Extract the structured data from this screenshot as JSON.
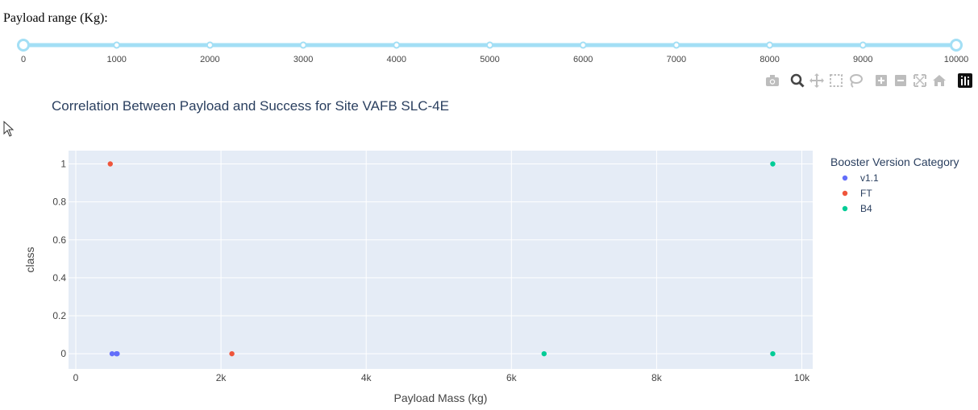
{
  "slider": {
    "label": "Payload range (Kg):",
    "min": 0,
    "max": 10000,
    "value_low": 0,
    "value_high": 10000,
    "marks": [
      "0",
      "1000",
      "2000",
      "3000",
      "4000",
      "5000",
      "6000",
      "7000",
      "8000",
      "9000",
      "10000"
    ],
    "track_color": "#a3dff5",
    "handle_color": "#a3dff5"
  },
  "modebar": {
    "icons": [
      "camera-icon",
      "zoom-icon",
      "pan-icon",
      "box-select-icon",
      "lasso-select-icon",
      "zoom-in-icon",
      "zoom-out-icon",
      "autoscale-icon",
      "reset-axes-icon",
      "plotly-logo-icon"
    ]
  },
  "chart_data": {
    "type": "scatter",
    "title": "Correlation Between Payload and Success for Site VAFB SLC-4E",
    "xlabel": "Payload Mass (kg)",
    "ylabel": "class",
    "xlim": [
      -100,
      10150
    ],
    "ylim": [
      -0.08,
      1.07
    ],
    "x_ticks": [
      0,
      2000,
      4000,
      6000,
      8000,
      10000
    ],
    "x_tick_labels": [
      "0",
      "2k",
      "4k",
      "6k",
      "8k",
      "10k"
    ],
    "y_ticks": [
      0,
      0.2,
      0.4,
      0.6,
      0.8,
      1
    ],
    "y_tick_labels": [
      "0",
      "0.2",
      "0.4",
      "0.6",
      "0.8",
      "1"
    ],
    "grid": true,
    "legend_title": "Booster Version Category",
    "legend_position": "right",
    "series": [
      {
        "name": "v1.1",
        "color": "#636efa",
        "points": [
          [
            500,
            0
          ],
          [
            560,
            0
          ],
          [
            570,
            0
          ]
        ]
      },
      {
        "name": "FT",
        "color": "#ef553b",
        "points": [
          [
            475,
            1
          ],
          [
            2150,
            0
          ]
        ]
      },
      {
        "name": "B4",
        "color": "#00cc96",
        "points": [
          [
            9600,
            1
          ],
          [
            6450,
            0
          ],
          [
            9600,
            0
          ]
        ]
      }
    ]
  }
}
